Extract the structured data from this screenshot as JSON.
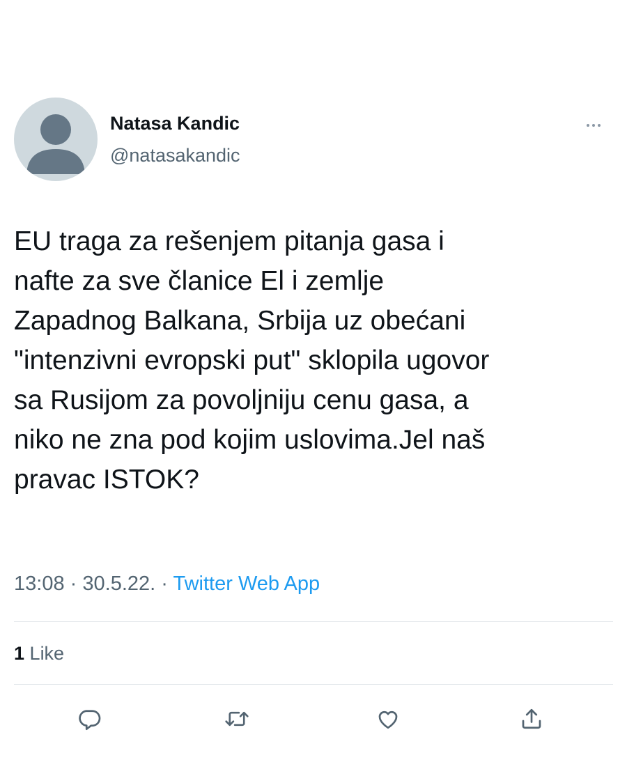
{
  "author": {
    "display_name": "Natasa Kandic",
    "handle": "@natasakandic"
  },
  "tweet": {
    "text_lines": [
      "EU traga za rešenjem pitanja gasa i",
      "nafte za sve članice El i zemlje",
      "Zapadnog Balkana, Srbija uz obećani",
      "\"intenzivni evropski put\" sklopila ugovor",
      "sa Rusijom za povoljniju cenu gasa, a",
      "niko ne zna pod kojim uslovima.Jel naš",
      "pravac ISTOK?"
    ],
    "time": "13:08",
    "date": "30.5.22.",
    "source": "Twitter Web App",
    "separator": "·"
  },
  "stats": {
    "likes_count": "1",
    "likes_label": "Like"
  },
  "icons": {
    "more": "more-horizontal-icon",
    "reply": "reply-icon",
    "retweet": "retweet-icon",
    "like": "heart-icon",
    "share": "share-icon"
  },
  "colors": {
    "text": "#0f1419",
    "secondary": "#536471",
    "link": "#1d9bf0",
    "avatar_bg": "#cfd9de",
    "avatar_fg": "#657786",
    "divider": "#e1e6ea"
  }
}
